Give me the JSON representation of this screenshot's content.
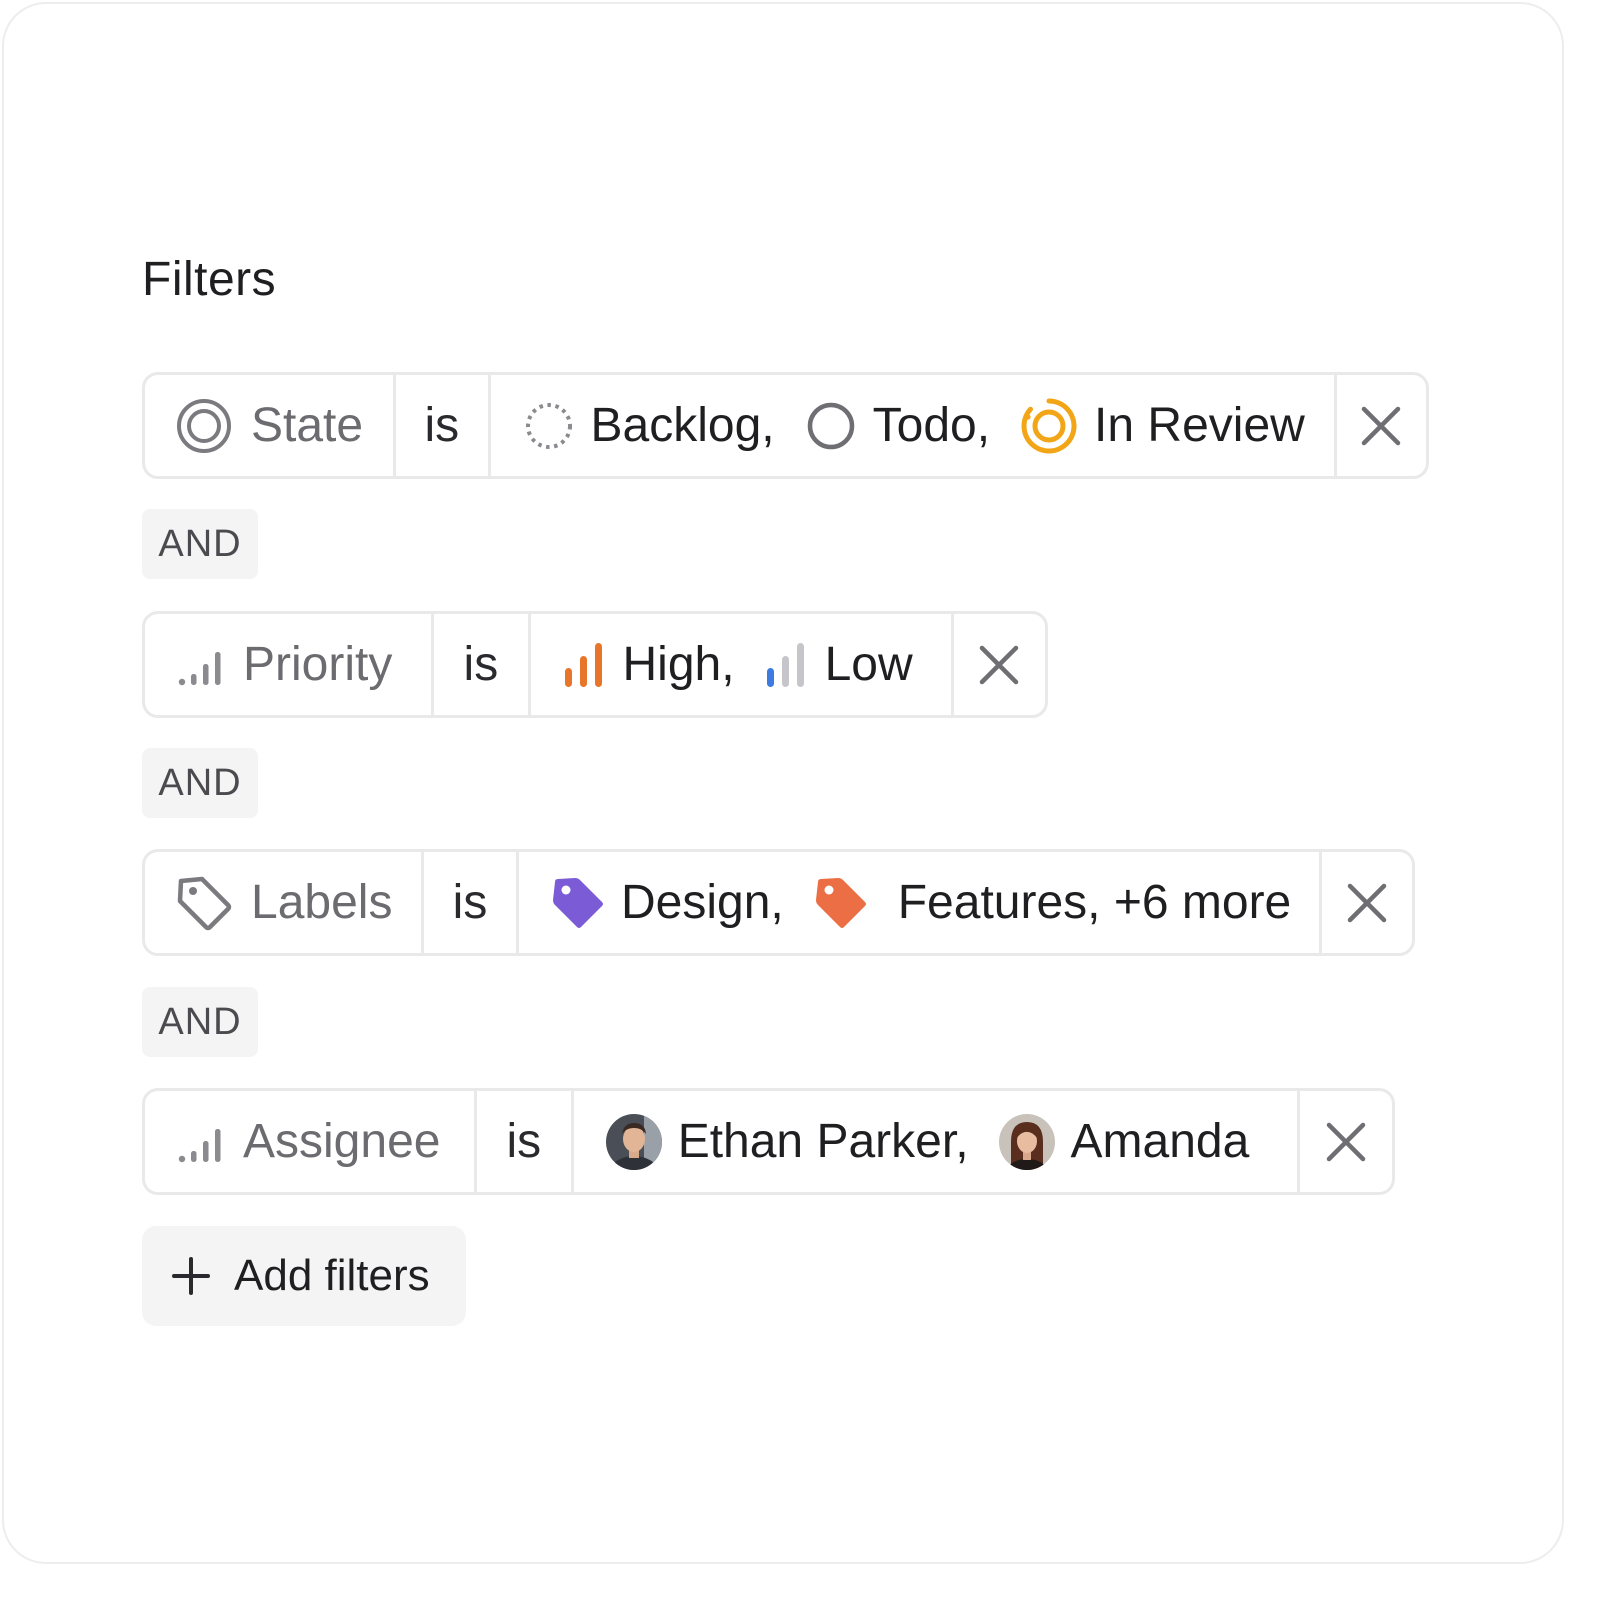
{
  "page": {
    "title": "Filters"
  },
  "filters": [
    {
      "field": "State",
      "field_icon": "state-circle-icon",
      "operator": "is",
      "values": [
        {
          "label": "Backlog,",
          "icon": "backlog-dashed-circle-icon"
        },
        {
          "label": "Todo,",
          "icon": "todo-circle-icon"
        },
        {
          "label": "In Review",
          "icon": "in-review-icon"
        }
      ],
      "close_icon": "close-icon"
    },
    {
      "field": "Priority",
      "field_icon": "priority-bars-icon",
      "operator": "is",
      "values": [
        {
          "label": "High,",
          "icon": "high-priority-icon"
        },
        {
          "label": "Low",
          "icon": "low-priority-icon"
        }
      ],
      "close_icon": "close-icon"
    },
    {
      "field": "Labels",
      "field_icon": "tag-outline-icon",
      "operator": "is",
      "values": [
        {
          "label": "Design,",
          "icon": "tag-purple-icon"
        },
        {
          "label": "Features, +6 more",
          "icon": "tag-orange-icon"
        }
      ],
      "close_icon": "close-icon"
    },
    {
      "field": "Assignee",
      "field_icon": "priority-bars-icon",
      "operator": "is",
      "values": [
        {
          "label": "Ethan Parker,",
          "icon": "avatar"
        },
        {
          "label": "Amanda",
          "icon": "avatar"
        }
      ],
      "close_icon": "close-icon"
    }
  ],
  "connectors": [
    "AND",
    "AND",
    "AND"
  ],
  "add_button": {
    "label": "Add filters",
    "icon": "plus-icon"
  },
  "colors": {
    "in_review": "#f2a516",
    "high_priority": "#e8762a",
    "low_priority_active": "#3d7be0",
    "tag_purple": "#7b5cd6",
    "tag_orange": "#eb6e45",
    "muted_icon": "#7a7a7f"
  }
}
